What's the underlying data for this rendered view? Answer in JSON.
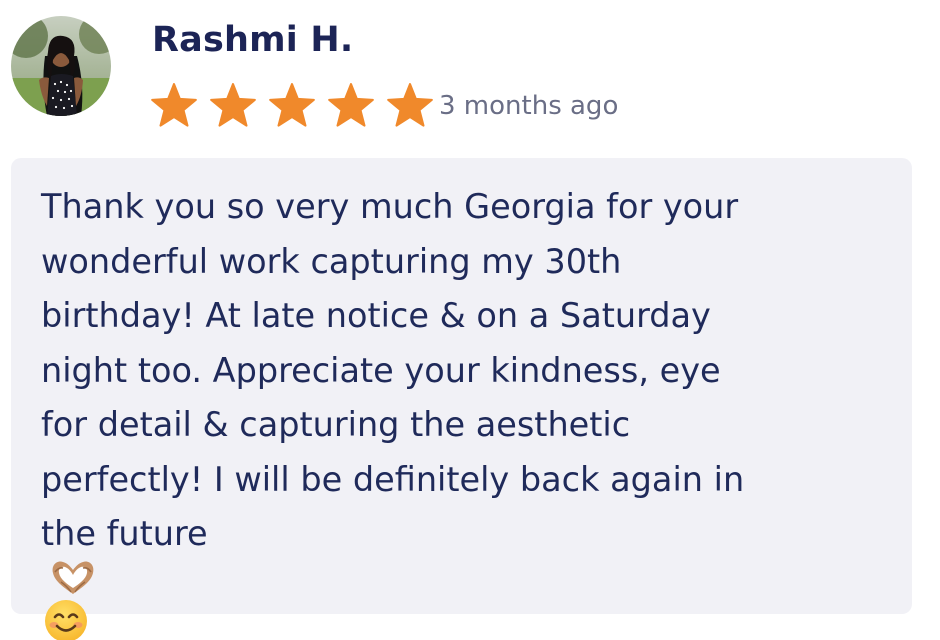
{
  "review": {
    "reviewer_name": "Rashmi H.",
    "rating": 5,
    "rating_max": 5,
    "timestamp": "3 months ago",
    "text_lines": [
      "Thank you so very much Georgia for your",
      "wonderful work capturing my 30th",
      "birthday! At late notice & on a Saturday",
      "night too. Appreciate your kindness, eye",
      "for detail & capturing the aesthetic",
      "perfectly! I will be definitely back again in",
      "the future"
    ],
    "emojis": [
      "heart-hands-emoji",
      "smiling-face-emoji"
    ]
  },
  "icons": {
    "star": "star-icon"
  },
  "colors": {
    "star": "#f0892b",
    "name": "#1c2456",
    "text": "#1f2a5a",
    "timestamp": "#6a6e86",
    "card_background": "#f1f1f6"
  }
}
